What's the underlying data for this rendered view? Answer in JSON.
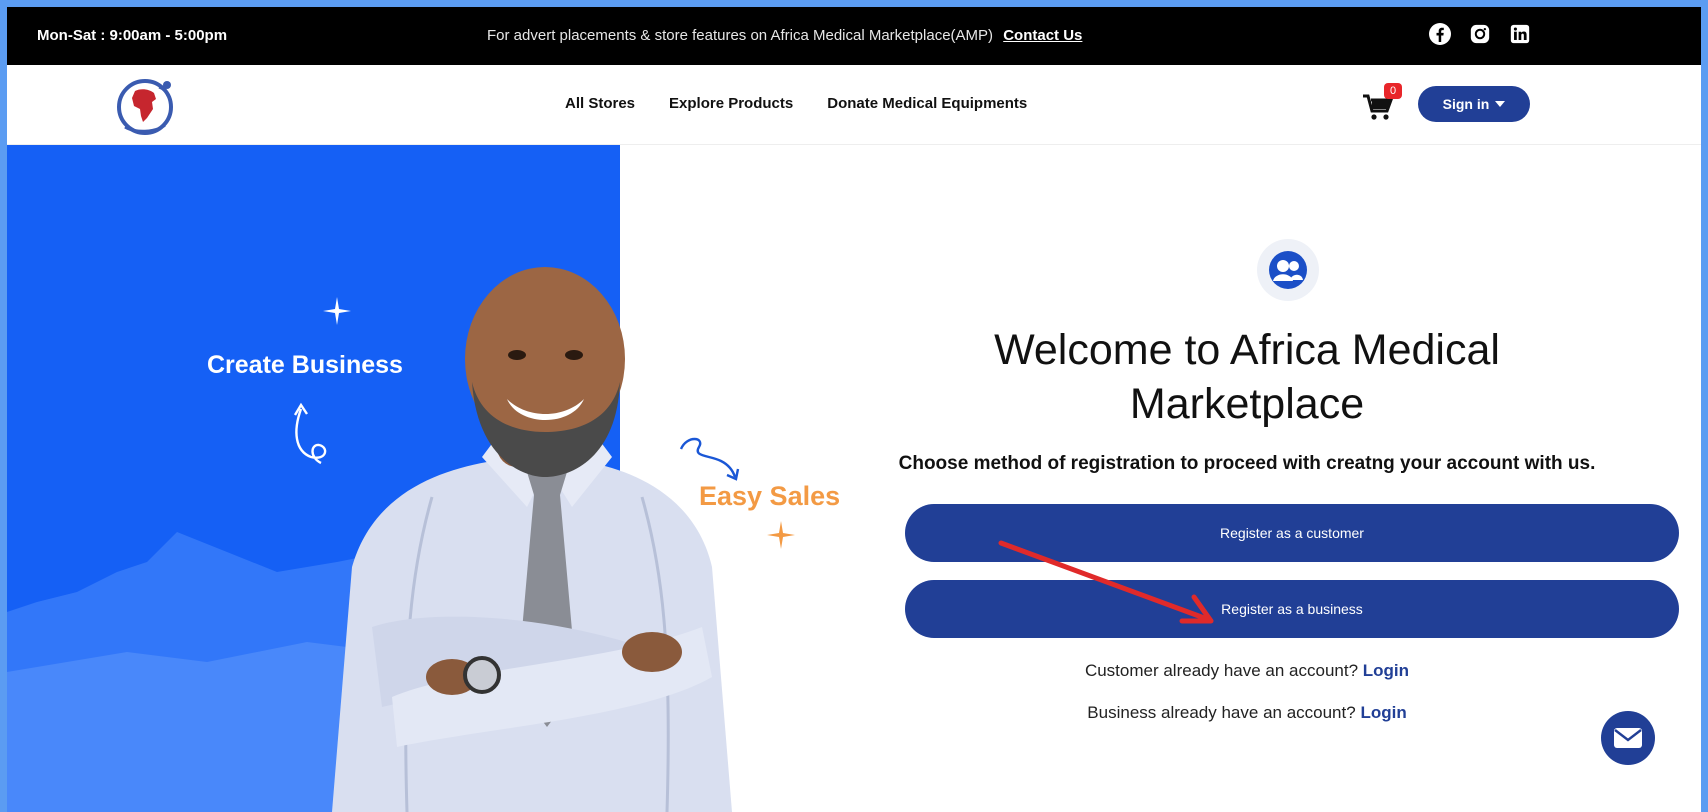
{
  "topbar": {
    "hours": "Mon-Sat : 9:00am - 5:00pm",
    "advert_text": "For advert placements & store features on Africa Medical Marketplace(AMP)",
    "contact_link": "Contact Us",
    "social_icons": [
      "facebook-icon",
      "instagram-icon",
      "linkedin-icon"
    ]
  },
  "nav": {
    "items": [
      "All Stores",
      "Explore Products",
      "Donate Medical Equipments"
    ],
    "cart_count": "0",
    "signin_label": "Sign in"
  },
  "hero": {
    "create_business": "Create Business",
    "easy_sales": "Easy Sales"
  },
  "main": {
    "title_line1": "Welcome to Africa Medical",
    "title_line2": "Marketplace",
    "instruction": "Choose method of registration to proceed with creatng your account with us.",
    "register_customer": "Register as a customer",
    "register_business": "Register as a business",
    "customer_login_prefix": "Customer already have an account?",
    "customer_login_link": "Login",
    "business_login_prefix": "Business already have an account?",
    "business_login_link": "Login"
  },
  "colors": {
    "primary": "#213f96",
    "hero_blue": "#1560f5",
    "accent_orange": "#f39a44",
    "arrow_red": "#e02a2a",
    "border": "#5b9cf2"
  }
}
